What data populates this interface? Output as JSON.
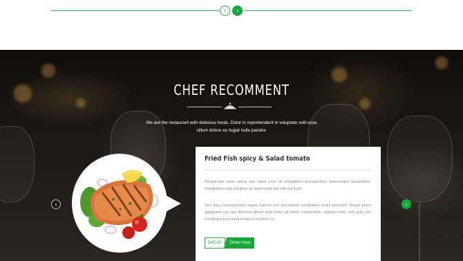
{
  "top_slider": {
    "prev_icon": "chevron-left-icon",
    "next_icon": "chevron-right-icon",
    "accent_color": "#15a83a"
  },
  "section": {
    "title": "CHEF RECOMMENT",
    "divider_icon": "cloche-icon",
    "description": "We are the restaurant with delicious foods. Dolor in reprehenderit in voluptate velit esse cillum dolore eu fugiat nulla pariatur"
  },
  "carousel": {
    "prev_icon": "chevron-left-icon",
    "next_icon": "chevron-right-icon"
  },
  "dish": {
    "image": "grilled-fish-with-salad-image",
    "title": "Fried Fish spicy & Salad tomato",
    "paragraph_1": "Perspiciatis unde omnis iste natus error sit voluptatem accusantium doloremque laudantium. Voluptatem quia voluptas sit aspernatur aut odit aut fugit.",
    "paragraph_2": "Sed quia consequuntur magni dolores eos qui ratione voluptatem sequi nesciunt. Neque porro quisquam est, qui dolorem ipsum quia dolor sit amet, consectetur, adipisci velit, sed quia non numquam eius modi tempora incidunt ut",
    "price": "$45.00",
    "order_label": "Order now"
  }
}
